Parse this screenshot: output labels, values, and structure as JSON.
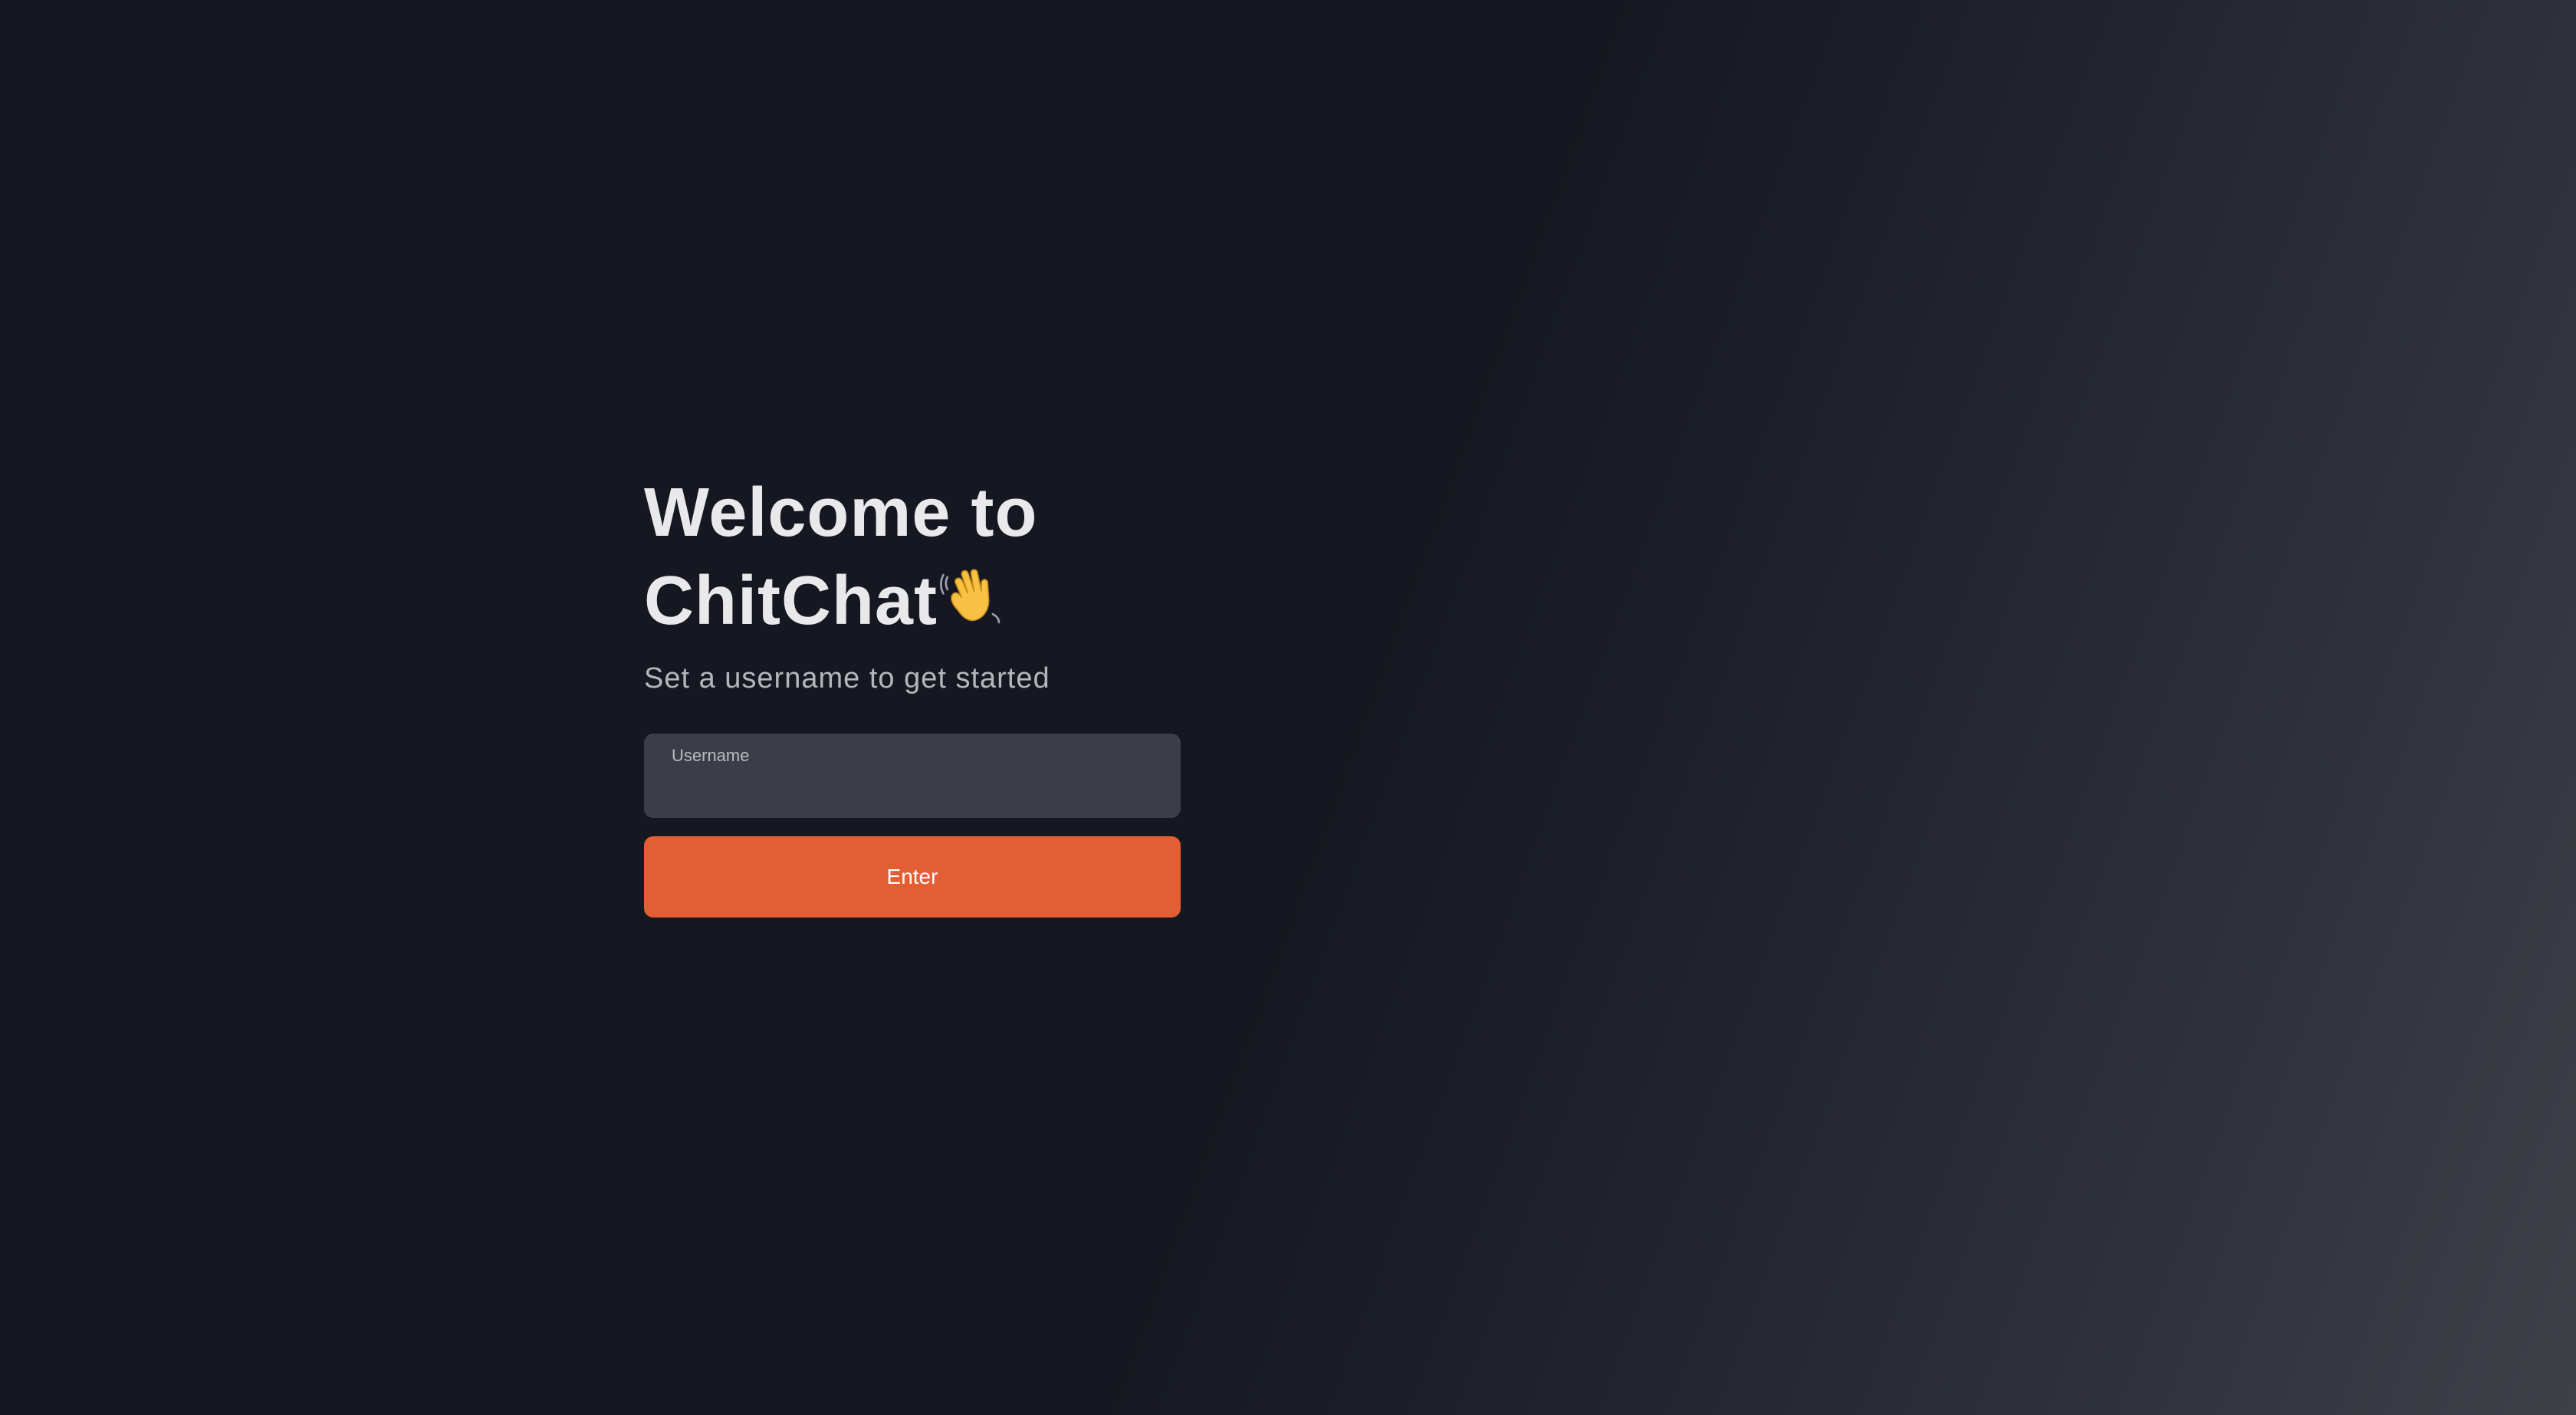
{
  "welcome": {
    "title_line1": "Welcome to",
    "title_line2": "ChitChat",
    "title_icon": "waving-hand-icon",
    "subtitle": "Set a username to get started"
  },
  "form": {
    "username_label": "Username",
    "username_value": "",
    "enter_label": "Enter"
  },
  "colors": {
    "background": "#151820",
    "field_background": "#3c3e47",
    "accent": "#e35e33",
    "text_primary": "#e9e9ec",
    "text_secondary": "#b4b6bd"
  }
}
